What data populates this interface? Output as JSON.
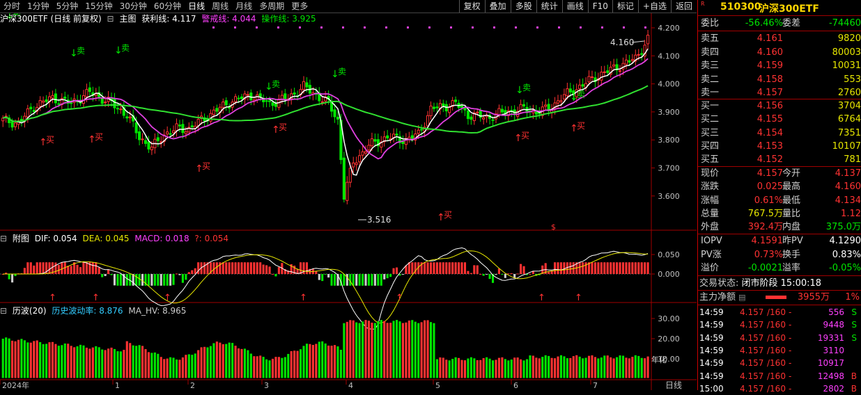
{
  "toolbar": {
    "periods": [
      "分时",
      "1分钟",
      "5分钟",
      "15分钟",
      "30分钟",
      "60分钟",
      "日线",
      "周线",
      "月线",
      "多周期",
      "更多"
    ],
    "active_period": "日线",
    "actions": [
      "复权",
      "叠加",
      "多股",
      "统计",
      "画线",
      "F10",
      "标记",
      "+自选",
      "返回"
    ]
  },
  "main_legend": {
    "title": "沪深300ETF (日线 前复权)",
    "chart_label": "主图",
    "profit_label": "获利线: 4.117",
    "warn_label": "警戒线: 4.044",
    "op_label": "操作线: 3.925"
  },
  "macd_legend": {
    "title": "附图",
    "dif": "DIF: 0.054",
    "dea": "DEA: 0.045",
    "macd": "MACD: 0.018",
    "q": "?: 0.054"
  },
  "vol_legend": {
    "title": "历波(20)",
    "hv": "历史波动率: 8.876",
    "mahv": "MA_HV: 8.965"
  },
  "chart_data": {
    "type": "candlestick",
    "price_ticks": [
      "4.200",
      "4.100",
      "4.000",
      "3.900",
      "3.800",
      "3.700",
      "3.600"
    ],
    "macd_ticks": [
      "0.050",
      "0.000"
    ],
    "vol_ticks": [
      "30.00",
      "20.00",
      "10.00"
    ],
    "x_labels": [
      "2024年",
      "1",
      "2",
      "3",
      "4",
      "5",
      "6",
      "7"
    ],
    "annotations": {
      "high": "4.160",
      "low": "3.516",
      "buy": "买",
      "sell": "卖",
      "dollar": "$",
      "year_tag": "年化"
    },
    "period_label": "日线",
    "ohlc_count": 140
  },
  "panel": {
    "code": "510300",
    "name": "沪深300ETF",
    "r_badge": "R",
    "weibi_label": "委比",
    "weibi": "-56.46%",
    "weicha_label": "委差",
    "weicha": "-74460",
    "asks": [
      {
        "label": "卖五",
        "price": "4.161",
        "vol": "9820"
      },
      {
        "label": "卖四",
        "price": "4.160",
        "vol": "80003"
      },
      {
        "label": "卖三",
        "price": "4.159",
        "vol": "10031"
      },
      {
        "label": "卖二",
        "price": "4.158",
        "vol": "553"
      },
      {
        "label": "卖一",
        "price": "4.157",
        "vol": "2760"
      }
    ],
    "bids": [
      {
        "label": "买一",
        "price": "4.156",
        "vol": "3704"
      },
      {
        "label": "买二",
        "price": "4.155",
        "vol": "6764"
      },
      {
        "label": "买三",
        "price": "4.154",
        "vol": "7351"
      },
      {
        "label": "买四",
        "price": "4.153",
        "vol": "10107"
      },
      {
        "label": "买五",
        "price": "4.152",
        "vol": "781"
      }
    ],
    "quote": [
      {
        "l1": "现价",
        "v1": "4.157",
        "c1": "red",
        "l2": "今开",
        "v2": "4.137",
        "c2": "red"
      },
      {
        "l1": "涨跌",
        "v1": "0.025",
        "c1": "red",
        "l2": "最高",
        "v2": "4.160",
        "c2": "red"
      },
      {
        "l1": "涨幅",
        "v1": "0.61%",
        "c1": "red",
        "l2": "最低",
        "v2": "4.134",
        "c2": "red"
      },
      {
        "l1": "总量",
        "v1": "767.5万",
        "c1": "yellow",
        "l2": "量比",
        "v2": "1.12",
        "c2": "red"
      },
      {
        "l1": "外盘",
        "v1": "392.4万",
        "c1": "red",
        "l2": "内盘",
        "v2": "375.0万",
        "c2": "green"
      }
    ],
    "iopv": [
      {
        "l1": "IOPV",
        "v1": "4.1591",
        "c1": "red",
        "l2": "昨PV",
        "v2": "4.1290",
        "c2": "white"
      },
      {
        "l1": "PV涨",
        "v1": "0.73%",
        "c1": "red",
        "l2": "换手",
        "v2": "0.83%",
        "c2": "white"
      },
      {
        "l1": "溢价",
        "v1": "-0.0021",
        "c1": "green",
        "l2": "溢率",
        "v2": "-0.05%",
        "c2": "green"
      }
    ],
    "status_label": "交易状态:",
    "status_value": "闭市阶段 15:00:18",
    "main_flow_label": "主力净额",
    "main_flow_value": "3955万",
    "main_flow_pct": "1%",
    "ticks": [
      {
        "time": "14:59",
        "price": "4.157",
        "lot": "/160",
        "dash": "-",
        "vol": "556",
        "side": "S"
      },
      {
        "time": "14:59",
        "price": "4.157",
        "lot": "/160",
        "dash": "-",
        "vol": "9448",
        "side": "S"
      },
      {
        "time": "14:59",
        "price": "4.157",
        "lot": "/160",
        "dash": "-",
        "vol": "19331",
        "side": "S"
      },
      {
        "time": "14:59",
        "price": "4.157",
        "lot": "/160",
        "dash": "-",
        "vol": "3110",
        "side": ""
      },
      {
        "time": "14:59",
        "price": "4.157",
        "lot": "/160",
        "dash": "-",
        "vol": "10917",
        "side": ""
      },
      {
        "time": "14:59",
        "price": "4.157",
        "lot": "/160",
        "dash": "-",
        "vol": "12498",
        "side": "B"
      },
      {
        "time": "15:00",
        "price": "4.157",
        "lot": "/160",
        "dash": "-",
        "vol": "2802",
        "side": "B"
      }
    ]
  },
  "colors": {
    "up": "#ff3232",
    "down": "#00e600",
    "ma_white": "#ffffff",
    "ma_magenta": "#e040e0",
    "ma_green": "#30e030",
    "axis": "#a00000"
  }
}
